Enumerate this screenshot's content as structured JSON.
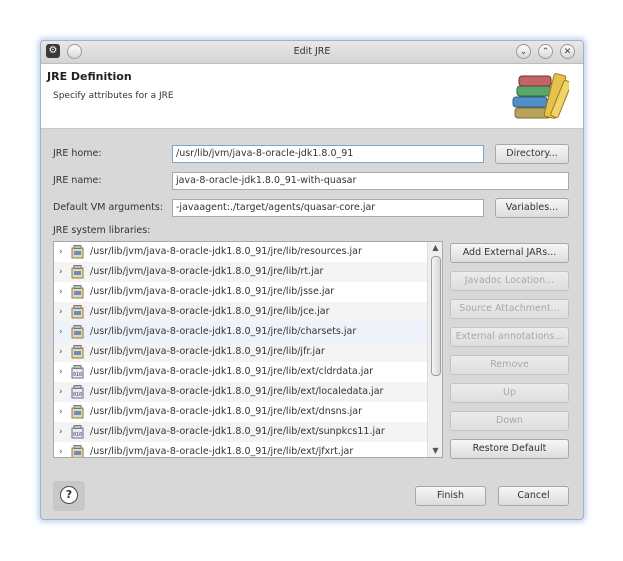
{
  "window": {
    "title": "Edit JRE",
    "app_icon": "eclipse-icon",
    "minimize_glyph": "⌄",
    "maximize_glyph": "⌃",
    "close_glyph": "✕",
    "menu_glyph": "⚙"
  },
  "header": {
    "title": "JRE Definition",
    "subtitle": "Specify attributes for a JRE"
  },
  "form": {
    "jre_home_label": "JRE home:",
    "jre_home_value": "/usr/lib/jvm/java-8-oracle-jdk1.8.0_91",
    "directory_button": "Directory...",
    "jre_name_label": "JRE name:",
    "jre_name_value": "java-8-oracle-jdk1.8.0_91-with-quasar",
    "vm_args_label": "Default VM arguments:",
    "vm_args_value": "-javaagent:./target/agents/quasar-core.jar",
    "variables_button": "Variables...",
    "libraries_label": "JRE system libraries:"
  },
  "libraries": [
    {
      "path": "/usr/lib/jvm/java-8-oracle-jdk1.8.0_91/jre/lib/resources.jar",
      "icon": "jar-icon"
    },
    {
      "path": "/usr/lib/jvm/java-8-oracle-jdk1.8.0_91/jre/lib/rt.jar",
      "icon": "jar-icon"
    },
    {
      "path": "/usr/lib/jvm/java-8-oracle-jdk1.8.0_91/jre/lib/jsse.jar",
      "icon": "jar-icon"
    },
    {
      "path": "/usr/lib/jvm/java-8-oracle-jdk1.8.0_91/jre/lib/jce.jar",
      "icon": "jar-icon"
    },
    {
      "path": "/usr/lib/jvm/java-8-oracle-jdk1.8.0_91/jre/lib/charsets.jar",
      "icon": "jar-icon"
    },
    {
      "path": "/usr/lib/jvm/java-8-oracle-jdk1.8.0_91/jre/lib/jfr.jar",
      "icon": "jar-icon"
    },
    {
      "path": "/usr/lib/jvm/java-8-oracle-jdk1.8.0_91/jre/lib/ext/cldrdata.jar",
      "icon": "binary-jar-icon"
    },
    {
      "path": "/usr/lib/jvm/java-8-oracle-jdk1.8.0_91/jre/lib/ext/localedata.jar",
      "icon": "binary-jar-icon"
    },
    {
      "path": "/usr/lib/jvm/java-8-oracle-jdk1.8.0_91/jre/lib/ext/dnsns.jar",
      "icon": "jar-icon"
    },
    {
      "path": "/usr/lib/jvm/java-8-oracle-jdk1.8.0_91/jre/lib/ext/sunpkcs11.jar",
      "icon": "binary-jar-icon"
    },
    {
      "path": "/usr/lib/jvm/java-8-oracle-jdk1.8.0_91/jre/lib/ext/jfxrt.jar",
      "icon": "jar-icon"
    }
  ],
  "side_buttons": {
    "add_external_jars": "Add External JARs...",
    "javadoc_location": "Javadoc Location...",
    "source_attachment": "Source Attachment...",
    "external_annotations": "External annotations...",
    "remove": "Remove",
    "up": "Up",
    "down": "Down",
    "restore_default": "Restore Default"
  },
  "footer": {
    "help_glyph": "?",
    "finish": "Finish",
    "cancel": "Cancel"
  }
}
